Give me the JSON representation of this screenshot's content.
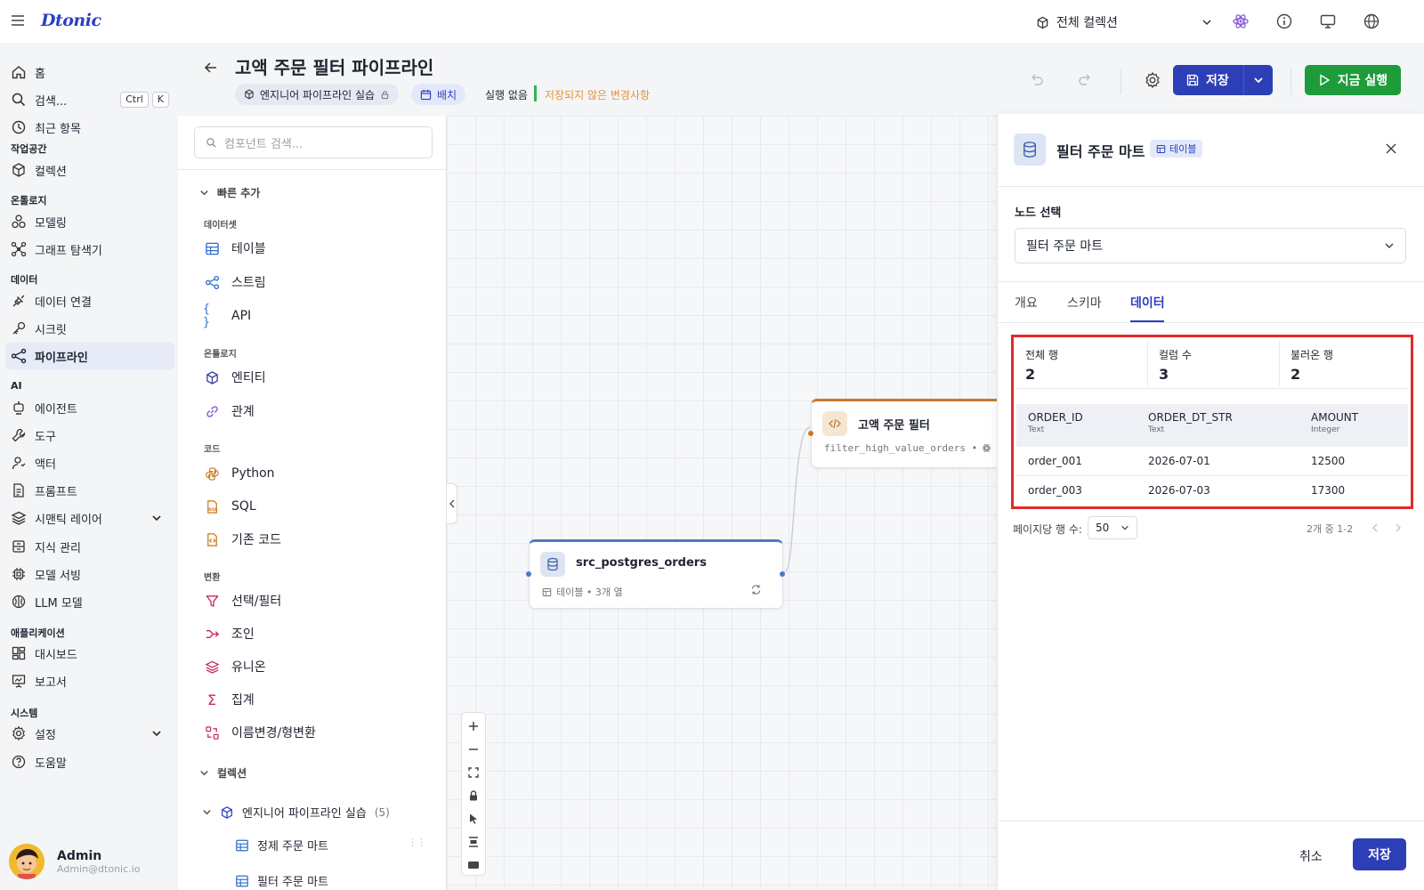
{
  "app": {
    "logo": "Dtonic"
  },
  "topbar": {
    "collection": "전체 컬렉션"
  },
  "sidebar": {
    "home": "홈",
    "search": "검색...",
    "kbd_ctrl": "Ctrl",
    "kbd_k": "K",
    "recent": "최근 항목",
    "sec_workspace": "작업공간",
    "collections": "컬렉션",
    "sec_ontology": "온톨로지",
    "modeling": "모델링",
    "graph": "그래프 탐색기",
    "sec_data": "데이터",
    "connection": "데이터 연결",
    "secret": "시크릿",
    "pipeline": "파이프라인",
    "sec_ai": "AI",
    "agent": "에이전트",
    "tools": "도구",
    "actor": "액터",
    "prompt": "프롬프트",
    "semantic": "시맨틱 레이어",
    "knowledge": "지식 관리",
    "serving": "모델 서빙",
    "llm": "LLM 모델",
    "sec_apps": "애플리케이션",
    "dashboard": "대시보드",
    "report": "보고서",
    "sec_system": "시스템",
    "settings": "설정",
    "help": "도움말",
    "user_name": "Admin",
    "user_mail": "Admin@dtonic.io"
  },
  "header": {
    "title": "고액 주문 필터 파이프라인",
    "chip_project": "엔지니어 파이프라인 실습",
    "chip_mode": "배치",
    "run_state": "실행 없음",
    "unsaved": "저장되지 않은 변경사항",
    "save": "저장",
    "run_now": "지금 실행"
  },
  "components": {
    "search_placeholder": "컴포넌트 검색...",
    "quick_add": "빠른 추가",
    "grp_dataset": "데이터셋",
    "table": "테이블",
    "stream": "스트림",
    "api": "API",
    "grp_ontology": "온톨로지",
    "entity": "엔티티",
    "relation": "관계",
    "grp_code": "코드",
    "python": "Python",
    "sql": "SQL",
    "existing_code": "기존 코드",
    "grp_transform": "변환",
    "select_filter": "선택/필터",
    "join": "조인",
    "union": "유니온",
    "aggregate": "집계",
    "rename_cast": "이름변경/형변환",
    "collections": "컬렉션",
    "coll_name": "엔지니어 파이프라인 실습",
    "coll_count": "(5)",
    "item1": "정제 주문 마트",
    "item2": "필터 주문 마트"
  },
  "canvas": {
    "node1_title": "src_postgres_orders",
    "node1_sub": "테이블 • 3개 열",
    "node2_title": "고액 주문 필터",
    "node2_sub": "filter_high_value_orders •"
  },
  "panel": {
    "title": "필터 주문 마트",
    "badge": "테이블",
    "node_select_label": "노드 선택",
    "node_select_value": "필터 주문 마트",
    "tabs": [
      "개요",
      "스키마",
      "데이터"
    ],
    "stats": [
      {
        "label": "전체 행",
        "value": "2"
      },
      {
        "label": "컬럼 수",
        "value": "3"
      },
      {
        "label": "불러온 행",
        "value": "2"
      }
    ],
    "columns": [
      {
        "name": "ORDER_ID",
        "type": "Text"
      },
      {
        "name": "ORDER_DT_STR",
        "type": "Text"
      },
      {
        "name": "AMOUNT",
        "type": "Integer"
      }
    ],
    "rows": [
      [
        "order_001",
        "2026-07-01",
        "12500"
      ],
      [
        "order_003",
        "2026-07-03",
        "17300"
      ]
    ],
    "page_size_label": "페이지당 행 수:",
    "page_size": "50",
    "page_range": "2개 중 1-2",
    "cancel": "취소",
    "save": "저장"
  },
  "colors": {
    "primary": "#2d3fb6",
    "run": "#1e9c3c",
    "highlight": "#e02b2b",
    "unsaved": "#e5942c"
  }
}
